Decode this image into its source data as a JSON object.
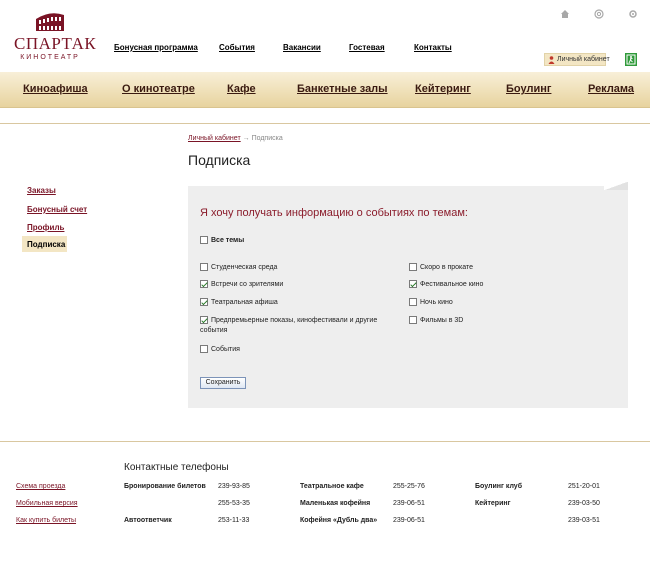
{
  "logo": {
    "brand": "СПАРТАК",
    "sub": "КИНОТЕАТР"
  },
  "topnav": [
    {
      "label": "Бонусная программа"
    },
    {
      "label": "События"
    },
    {
      "label": "Вакансии"
    },
    {
      "label": "Гостевая"
    },
    {
      "label": "Контакты"
    }
  ],
  "utility": {
    "icons": [
      "home-icon",
      "email-icon",
      "sitemap-icon"
    ],
    "cabinet": "Личный кабинет",
    "exit_icon": "exit-icon"
  },
  "mainnav": [
    {
      "label": "Киноафиша"
    },
    {
      "label": "О кинотеатре"
    },
    {
      "label": "Кафе"
    },
    {
      "label": "Банкетные залы"
    },
    {
      "label": "Кейтеринг"
    },
    {
      "label": "Боулинг"
    },
    {
      "label": "Реклама"
    }
  ],
  "breadcrumb": {
    "parent": "Личный кабинет",
    "separator": "→",
    "current": "Подписка"
  },
  "page_title": "Подписка",
  "sidebar": [
    {
      "label": "Заказы"
    },
    {
      "label": "Бонусный счет"
    },
    {
      "label": "Профиль"
    },
    {
      "label": "Подписка",
      "active": true
    }
  ],
  "subscription": {
    "heading": "Я хочу получать информацию о событиях по темам:",
    "all_topics": {
      "label": "Все темы",
      "checked": false
    },
    "left": [
      {
        "label": "Студенческая среда",
        "checked": false
      },
      {
        "label": "Встречи со зрителями",
        "checked": true
      },
      {
        "label": "Театральная афиша",
        "checked": true
      },
      {
        "label": "Предпремьерные показы, кинофестивали и другие",
        "label2": "события",
        "checked": true
      },
      {
        "label": "События",
        "checked": false
      }
    ],
    "right": [
      {
        "label": "Скоро в прокате",
        "checked": false
      },
      {
        "label": "Фестивальное кино",
        "checked": true
      },
      {
        "label": "Ночь кино",
        "checked": false
      },
      {
        "label": "Фильмы в 3D",
        "checked": false
      }
    ],
    "save_label": "Сохранить"
  },
  "footer": {
    "title": "Контактные телефоны",
    "links": [
      "Схема проезда",
      "Мобильная версия",
      "Как купить билеты"
    ],
    "col1": [
      {
        "name": "Бронирование билетов",
        "phone": "239-93-85"
      },
      {
        "name": "",
        "phone": "255-53-35"
      },
      {
        "name": "Автоответчик",
        "phone": "253-11-33"
      }
    ],
    "col2": [
      {
        "name": "Театральное кафе",
        "phone": "255-25-76"
      },
      {
        "name": "Маленькая кофейня",
        "phone": "239-06-51"
      },
      {
        "name": "Кофейня «Дубль два»",
        "phone": "239-06-51"
      }
    ],
    "col3": [
      {
        "name": "Боулинг клуб",
        "phone": "251-20-01"
      },
      {
        "name": "Кейтеринг",
        "phone": "239-03-50"
      },
      {
        "name": "",
        "phone": "239-03-51"
      }
    ]
  },
  "colors": {
    "brand": "#7a1426",
    "heading": "#8b1d2c",
    "nav_bg": "#efe0b8",
    "panel_bg": "#eeeeee",
    "accent_bg": "#f3e6c4"
  }
}
